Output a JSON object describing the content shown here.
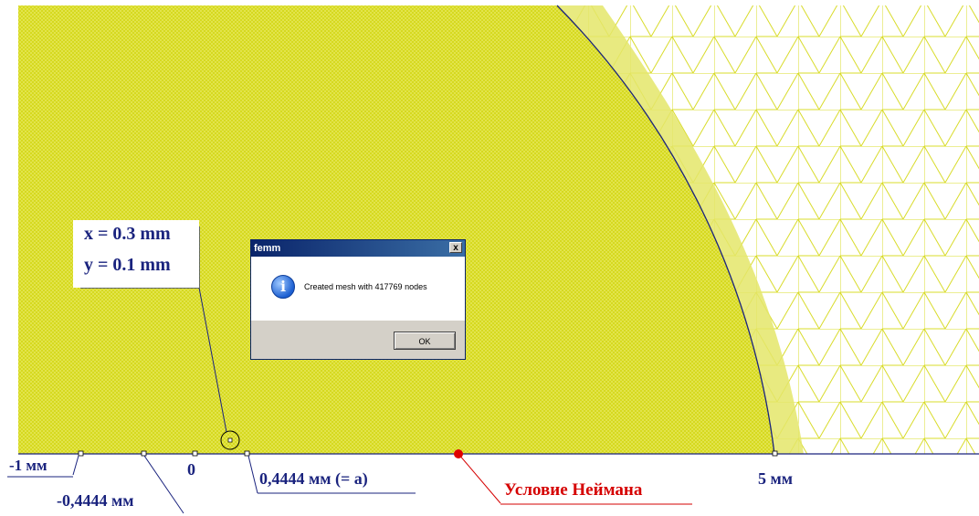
{
  "colors": {
    "mesh_fill": "#dadc25",
    "mesh_line": "#e6e84c",
    "boundary": "#1a237e",
    "accent_red": "#d50000"
  },
  "annotation": {
    "x_label": "x = 0.3 mm",
    "y_label": "y = 0.1 mm"
  },
  "axis_labels": {
    "minus_one": "-1 мм",
    "minus_a": "-0,4444 мм",
    "zero": "0",
    "plus_a": "0,4444 мм (= a)",
    "neumann": "Условие Неймана",
    "five": "5 мм"
  },
  "dialog": {
    "title": "femm",
    "close_glyph": "x",
    "icon": "information-icon",
    "message": "Created mesh with 417769 nodes",
    "ok_label": "OK"
  }
}
